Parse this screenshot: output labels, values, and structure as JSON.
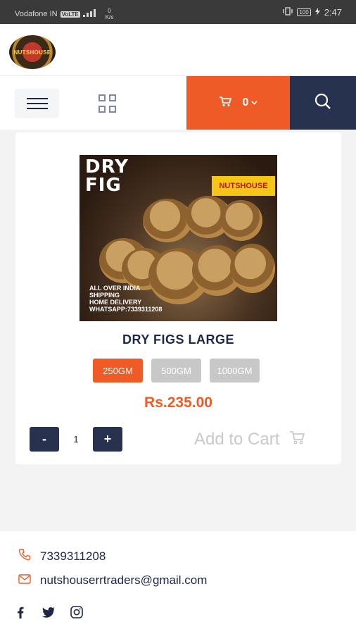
{
  "status_bar": {
    "carrier": "Vodafone IN",
    "network_badge": "VoLTE",
    "speed_value": "0",
    "speed_unit": "K/s",
    "battery": "100",
    "time": "2:47"
  },
  "header": {
    "logo_text": "NUTSHOUSE"
  },
  "navbar": {
    "cart_count": "0"
  },
  "product": {
    "image_title_line1": "DRY",
    "image_title_line2": "FIG",
    "image_brand": "NUTSHOUSE",
    "image_caption_line1": "ALL OVER INDIA",
    "image_caption_line2": "SHIPPING",
    "image_caption_line3": "HOME DELIVERY",
    "image_caption_line4": "WHATSAPP:7339311208",
    "name": "DRY FIGS LARGE",
    "variants": [
      {
        "label": "250GM",
        "selected": true
      },
      {
        "label": "500GM",
        "selected": false
      },
      {
        "label": "1000GM",
        "selected": false
      }
    ],
    "price": "Rs.235.00",
    "qty_minus": "-",
    "quantity": "1",
    "qty_plus": "+",
    "add_to_cart": "Add to Cart"
  },
  "footer": {
    "phone": "7339311208",
    "email": "nutshouserrtraders@gmail.com",
    "socials": [
      "facebook-icon",
      "twitter-icon",
      "instagram-icon"
    ]
  },
  "colors": {
    "accent": "#ef5b27",
    "navy": "#27324e",
    "text_dark": "#1f2747",
    "muted": "#c8c8c8"
  }
}
